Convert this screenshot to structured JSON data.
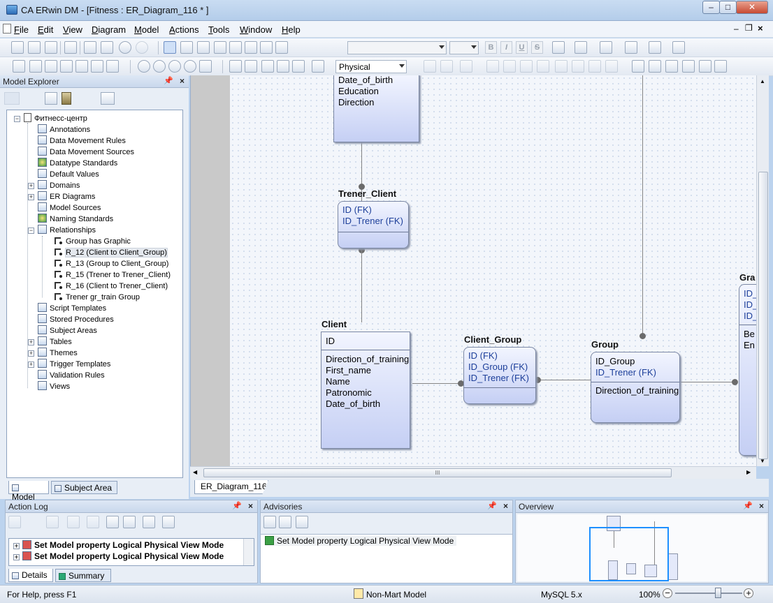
{
  "window": {
    "title": "CA ERwin DM - [Fitness : ER_Diagram_116 * ]"
  },
  "menu": [
    {
      "label": "File",
      "u": "F"
    },
    {
      "label": "Edit",
      "u": "E"
    },
    {
      "label": "View",
      "u": "V"
    },
    {
      "label": "Diagram",
      "u": "D"
    },
    {
      "label": "Model",
      "u": "M"
    },
    {
      "label": "Actions",
      "u": "A"
    },
    {
      "label": "Tools",
      "u": "T"
    },
    {
      "label": "Window",
      "u": "W"
    },
    {
      "label": "Help",
      "u": "H"
    }
  ],
  "toolbar": {
    "view_mode": "Physical",
    "font_letters": [
      "B",
      "I",
      "U",
      "S"
    ]
  },
  "model_explorer": {
    "title": "Model Explorer",
    "root": "Фитнесс-центр",
    "items": [
      {
        "label": "Annotations",
        "expandable": false
      },
      {
        "label": "Data Movement Rules",
        "expandable": false
      },
      {
        "label": "Data Movement Sources",
        "expandable": false
      },
      {
        "label": "Datatype Standards",
        "expandable": false
      },
      {
        "label": "Default Values",
        "expandable": false
      },
      {
        "label": "Domains",
        "expandable": true
      },
      {
        "label": "ER Diagrams",
        "expandable": true
      },
      {
        "label": "Model Sources",
        "expandable": false
      },
      {
        "label": "Naming Standards",
        "expandable": false
      },
      {
        "label": "Relationships",
        "expandable": true,
        "expanded": true
      }
    ],
    "relationships": [
      "Group has Graphic",
      "R_12 (Client to Client_Group)",
      "R_13 (Group to Client_Group)",
      "R_15 (Trener to Trener_Client)",
      "R_16 (Client to Trener_Client)",
      "Trener gr_train Group"
    ],
    "selected_relationship": "R_12 (Client to Client_Group)",
    "items_after": [
      {
        "label": "Script Templates",
        "expandable": false
      },
      {
        "label": "Stored Procedures",
        "expandable": false
      },
      {
        "label": "Subject Areas",
        "expandable": false
      },
      {
        "label": "Tables",
        "expandable": true
      },
      {
        "label": "Themes",
        "expandable": true
      },
      {
        "label": "Trigger Templates",
        "expandable": true
      },
      {
        "label": "Validation Rules",
        "expandable": false
      },
      {
        "label": "Views",
        "expandable": false
      }
    ],
    "tabs": [
      "Model",
      "Subject Area"
    ]
  },
  "diagram": {
    "trener_top": {
      "attrs": [
        "Date_of_birth",
        "Education",
        "Direction"
      ]
    },
    "trener_client": {
      "name": "Trener_Client",
      "keys": [
        "ID (FK)",
        "ID_Trener (FK)"
      ]
    },
    "client": {
      "name": "Client",
      "keys": [
        "ID"
      ],
      "attrs": [
        "Direction_of_training",
        "First_name",
        "Name",
        "Patronomic",
        "Date_of_birth"
      ]
    },
    "client_group": {
      "name": "Client_Group",
      "keys": [
        "ID (FK)",
        "ID_Group (FK)",
        "ID_Trener (FK)"
      ]
    },
    "group": {
      "name": "Group",
      "keys": [
        "ID_Group",
        "ID_Trener (FK)"
      ],
      "attrs": [
        "Direction_of_training"
      ]
    },
    "partial": {
      "name": "Gra",
      "keys": [
        "ID_",
        "ID_",
        "ID_"
      ],
      "attrs": [
        "Be",
        "En"
      ]
    }
  },
  "doc_tab": "ER_Diagram_116",
  "hscroll_thumb": "III",
  "action_log": {
    "title": "Action Log",
    "rows": [
      "Set Model property Logical Physical View Mode",
      "Set Model property Logical Physical View Mode"
    ],
    "tabs": [
      "Details",
      "Summary"
    ]
  },
  "advisories": {
    "title": "Advisories",
    "rows": [
      "Set Model property Logical Physical View Mode"
    ]
  },
  "overview": {
    "title": "Overview"
  },
  "status": {
    "help": "For Help, press F1",
    "mart": "Non-Mart Model",
    "db": "MySQL 5.x",
    "zoom": "100%",
    "zoom_level": 0.64
  }
}
